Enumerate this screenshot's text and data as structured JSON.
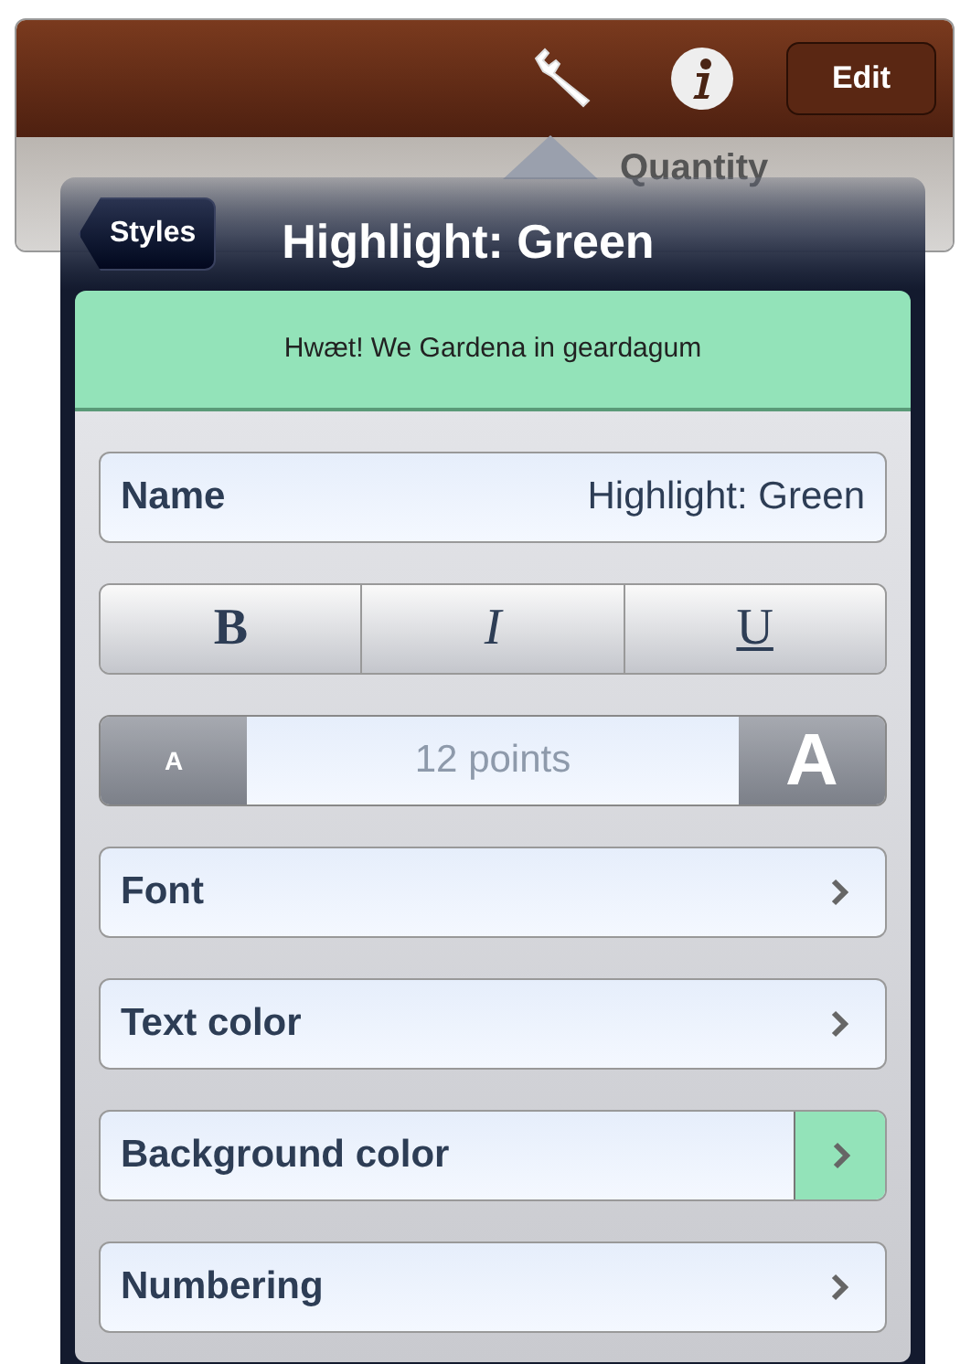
{
  "toolbar": {
    "edit_button": "Edit"
  },
  "table_header": {
    "column_label": "Quantity"
  },
  "popover": {
    "back_button": "Styles",
    "title": "Highlight: Green",
    "preview": {
      "text": "Hwæt! We Gardena in geardagum",
      "color": "#93e3b9"
    },
    "name_field": {
      "label": "Name",
      "value": "Highlight: Green"
    },
    "style_buttons": [
      {
        "label": "B",
        "kind": "bold"
      },
      {
        "label": "I",
        "kind": "italic"
      },
      {
        "label": "U",
        "kind": "underline"
      }
    ],
    "font_size": {
      "decrease": "A",
      "value": "12 points",
      "increase": "A"
    },
    "options": [
      {
        "label": "Font"
      },
      {
        "label": "Text color"
      },
      {
        "label": "Background color",
        "color": "#93e3b9"
      },
      {
        "label": "Numbering"
      }
    ]
  }
}
